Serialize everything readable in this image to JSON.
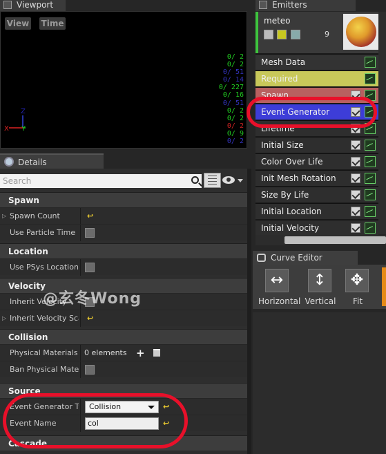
{
  "viewport": {
    "tab_label": "Viewport",
    "view_button": "View",
    "time_button": "Time",
    "stats": [
      {
        "text": "0/  2",
        "color": "#22cc22"
      },
      {
        "text": "0/  2",
        "color": "#22cc22"
      },
      {
        "text": "0/ 51",
        "color": "#3333bb"
      },
      {
        "text": "0/ 14",
        "color": "#3333bb"
      },
      {
        "text": "0/ 227",
        "color": "#22cc22"
      },
      {
        "text": "0/ 16",
        "color": "#22cc22"
      },
      {
        "text": "0/ 51",
        "color": "#3333bb"
      },
      {
        "text": "0/  2",
        "color": "#22cc22"
      },
      {
        "text": "0/  2",
        "color": "#22cc22"
      },
      {
        "text": "0/  2",
        "color": "#cc2222"
      },
      {
        "text": "0/  9",
        "color": "#22cc22"
      },
      {
        "text": "0/  2",
        "color": "#3333bb"
      }
    ],
    "axis_z": "Z",
    "axis_x": "X",
    "axis_y": "Y"
  },
  "details": {
    "tab_label": "Details",
    "search_placeholder": "Search",
    "categories": {
      "spawn": "Spawn",
      "location": "Location",
      "velocity": "Velocity",
      "collision": "Collision",
      "source": "Source",
      "cascade": "Cascade"
    },
    "props": {
      "spawn_count": "Spawn Count",
      "use_particle_time": "Use Particle Time",
      "use_psys_location": "Use PSys Location",
      "inherit_velocity": "Inherit Velocity",
      "inherit_velocity_scale": "Inherit Velocity Scal",
      "physical_materials": "Physical Materials",
      "physical_materials_value": "0 elements",
      "ban_physical_materials": "Ban Physical Materi",
      "event_generator_type": "Event Generator Typ",
      "event_generator_type_value": "Collision",
      "event_name": "Event Name",
      "event_name_value": "col"
    },
    "reset_glyph": "↩",
    "watermark": "@玄冬Wong"
  },
  "emitters": {
    "tab_label": "Emitters",
    "emitter_name": "meteo",
    "emitter_count": "9",
    "modules": [
      {
        "label": "Mesh Data",
        "bg": "#333333",
        "check": false
      },
      {
        "label": "Required",
        "bg": "#c8c85a",
        "check": false
      },
      {
        "label": "Spawn",
        "bg": "#b86060",
        "check": true
      },
      {
        "label": "Event Generator",
        "bg": "#3d3dd8",
        "check": true
      },
      {
        "label": "Lifetime",
        "bg": "#2e2e2e",
        "check": true
      },
      {
        "label": "Initial Size",
        "bg": "#2e2e2e",
        "check": true
      },
      {
        "label": "Color Over Life",
        "bg": "#2e2e2e",
        "check": true
      },
      {
        "label": "Init Mesh Rotation",
        "bg": "#2e2e2e",
        "check": true
      },
      {
        "label": "Size By Life",
        "bg": "#2e2e2e",
        "check": true
      },
      {
        "label": "Initial Location",
        "bg": "#2e2e2e",
        "check": true
      },
      {
        "label": "Initial Velocity",
        "bg": "#2e2e2e",
        "check": true
      }
    ]
  },
  "curve_editor": {
    "tab_label": "Curve Editor",
    "tools": [
      {
        "label": "Horizontal",
        "glyph": "↔"
      },
      {
        "label": "Vertical",
        "glyph": "↕"
      },
      {
        "label": "Fit",
        "glyph": "✥"
      }
    ]
  },
  "colors": {
    "annotation": "#e8102a",
    "accent_orange": "#e58a18",
    "selected_module": "#3d3dd8"
  }
}
